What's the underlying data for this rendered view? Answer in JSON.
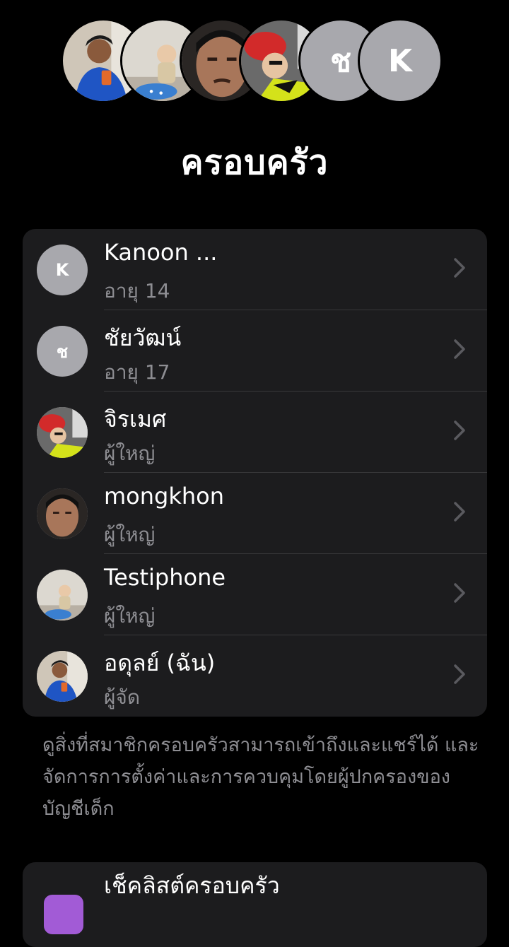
{
  "header": {
    "title": "ครอบครัว",
    "avatars": [
      {
        "type": "photo",
        "icon": "person-photo-icon"
      },
      {
        "type": "photo",
        "icon": "child-photo-icon"
      },
      {
        "type": "photo",
        "icon": "face-photo-icon"
      },
      {
        "type": "photo",
        "icon": "red-cap-photo-icon"
      },
      {
        "type": "letter",
        "letter": "ช"
      },
      {
        "type": "letter",
        "letter": "K"
      }
    ]
  },
  "members": [
    {
      "name": "Kanoon ...",
      "sub": "อายุ 14",
      "avatar_letter": "K"
    },
    {
      "name": "ชัยวัฒน์",
      "sub": "อายุ 17",
      "avatar_letter": "ช"
    },
    {
      "name": "จิรเมศ",
      "sub": "ผู้ใหญ่",
      "avatar_icon": "red-cap-photo-icon"
    },
    {
      "name": "mongkhon",
      "sub": "ผู้ใหญ่",
      "avatar_icon": "face-photo-icon"
    },
    {
      "name": "Testiphone",
      "sub": "ผู้ใหญ่",
      "avatar_icon": "child-photo-icon"
    },
    {
      "name": "อดุลย์ (ฉัน)",
      "sub": "ผู้จัด",
      "avatar_icon": "person-photo-icon"
    }
  ],
  "note": "ดูสิ่งที่สมาชิกครอบครัวสามารถเข้าถึงและแชร์ได้ และจัดการการตั้งค่าและการควบคุมโดยผู้ปกครองของบัญชีเด็ก",
  "checklist": {
    "label": "เช็คลิสต์ครอบครัว",
    "icon": "checklist-icon"
  },
  "colors": {
    "background": "#000000",
    "card": "#1c1c1e",
    "secondary_text": "#8e8e93",
    "letter_avatar": "#a8a8ad",
    "checklist_icon": "#a25bd6"
  }
}
